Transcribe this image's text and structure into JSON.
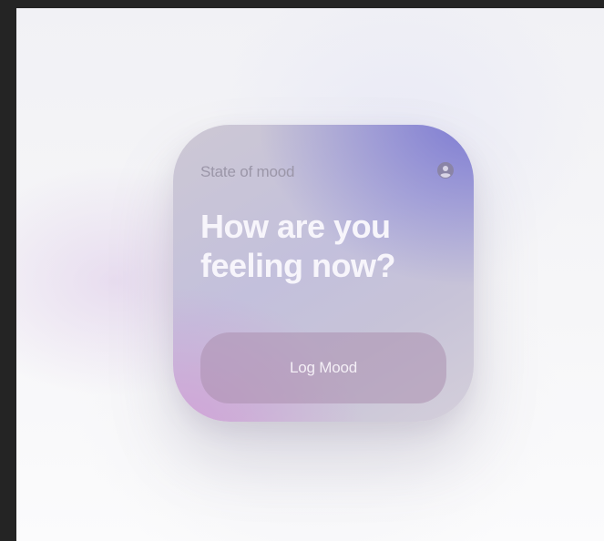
{
  "widget": {
    "title": "State of mood",
    "question": "How are you feeling now?",
    "button_label": "Log Mood",
    "profile_icon": "person-circle-icon"
  },
  "colors": {
    "background": "#f3f3f6",
    "widget_purple": "#7876d2",
    "widget_pink": "#d2a0d7",
    "question_text": "#f7f5fb",
    "title_text": "#9b96a8",
    "button_fill": "#ac90af"
  }
}
